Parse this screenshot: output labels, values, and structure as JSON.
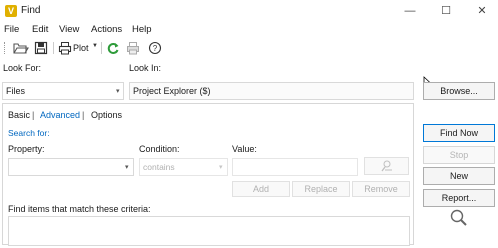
{
  "window": {
    "title": "Find",
    "icon_name": "vault-app-icon",
    "minimize_glyph": "—",
    "maximize_glyph": "☐",
    "close_glyph": "✕"
  },
  "menu": {
    "items": [
      {
        "label": "File"
      },
      {
        "label": "Edit"
      },
      {
        "label": "View"
      },
      {
        "label": "Actions"
      },
      {
        "label": "Help"
      }
    ]
  },
  "toolbar": {
    "plot_label": "Plot",
    "icons": [
      "open-folder-icon",
      "save-icon",
      "print-icon",
      "refresh-icon",
      "printer-disabled-icon",
      "help-icon"
    ]
  },
  "look_for": {
    "label": "Look For:",
    "value": "Files"
  },
  "look_in": {
    "label": "Look In:",
    "value": "Project Explorer ($)"
  },
  "tabs": {
    "basic": "Basic",
    "advanced": "Advanced",
    "options": "Options",
    "separator": "|"
  },
  "search_for": {
    "label": "Search for:",
    "property_label": "Property:",
    "condition_label": "Condition:",
    "condition_value": "contains",
    "value_label": "Value:",
    "add_label": "Add",
    "replace_label": "Replace",
    "remove_label": "Remove",
    "criteria_label": "Find items that match these criteria:"
  },
  "actions": {
    "browse": "Browse...",
    "find_now": "Find Now",
    "stop": "Stop",
    "new": "New",
    "report": "Report..."
  },
  "colors": {
    "link": "#0067c0",
    "accent_border": "#0078d7",
    "disabled_text": "#b1b1b1",
    "refresh_green": "#2e9b3a",
    "app_icon": "#e0b000"
  }
}
